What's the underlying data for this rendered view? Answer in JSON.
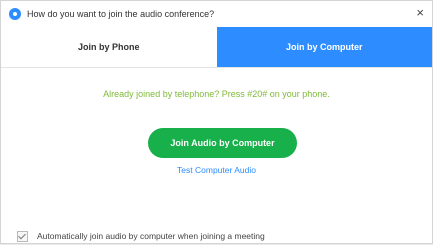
{
  "window": {
    "title": "How do you want to join the audio conference?",
    "close_glyph": "×"
  },
  "tabs": [
    {
      "label": "Join by Phone",
      "selected": false
    },
    {
      "label": "Join by Computer",
      "selected": true
    }
  ],
  "notice": "Already joined by telephone? Press #20# on your phone.",
  "join_button_label": "Join Audio by Computer",
  "test_link_label": "Test Computer Audio",
  "auto_join": {
    "label": "Automatically join audio by computer when joining a meeting",
    "checked": true
  },
  "colors": {
    "accent": "#2d8cff",
    "join_button": "#17b04a",
    "notice_text": "#7fb93a"
  },
  "icons": {
    "app": "zoom-app-icon",
    "close": "close-icon",
    "checkbox": "checkmark-icon"
  }
}
